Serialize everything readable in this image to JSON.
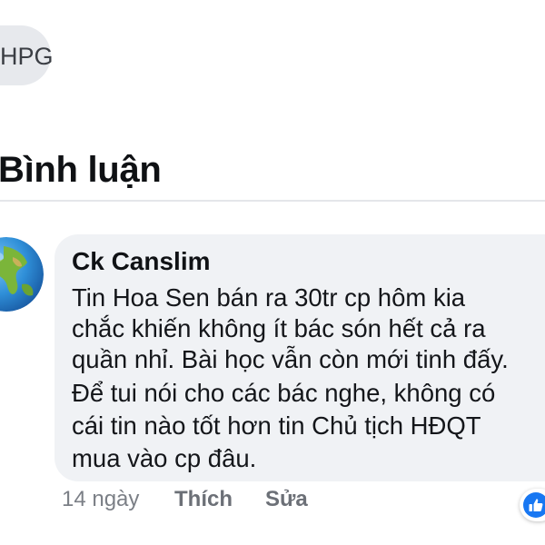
{
  "tag": {
    "label": "HPG"
  },
  "section": {
    "title": "Bình luận"
  },
  "comment": {
    "author": "Ck Canslim",
    "lines": [
      "Tin Hoa Sen bán ra 30tr cp hôm kia",
      "chắc khiến không ít bác són hết cả ra",
      "quần nhỉ. Bài học vẫn còn mới tinh đấy.",
      "Để tui nói cho các bác nghe, không có",
      "cái tin nào tốt hơn tin Chủ tịch HĐQT",
      "mua vào cp đâu."
    ],
    "time": "14 ngày",
    "like_label": "Thích",
    "edit_label": "Sửa",
    "reaction_icon": "like-thumb-icon",
    "avatar_icon": "globe-icon"
  },
  "colors": {
    "bubble": "#f0f2f5",
    "reaction": "#1877f2",
    "meta": "#7b7f86"
  }
}
